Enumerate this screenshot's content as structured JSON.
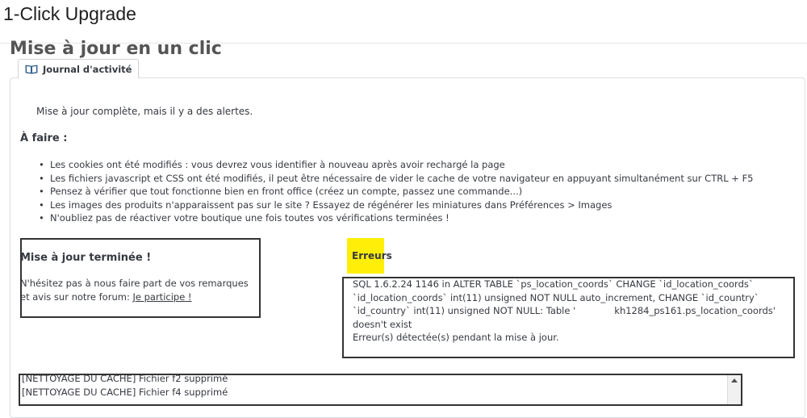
{
  "app": {
    "title": "1-Click Upgrade"
  },
  "page": {
    "title": "Mise à jour en un clic"
  },
  "tab": {
    "label": "Journal d'activité",
    "icon": "book-icon"
  },
  "status": {
    "message": "Mise à jour complète, mais il y a des alertes."
  },
  "todo": {
    "heading": "À faire :",
    "items": [
      "Les cookies ont été modifiés : vous devrez vous identifier à nouveau après avoir rechargé la page",
      "Les fichiers javascript et CSS ont été modifiés, il peut être nécessaire de vider le cache de votre navigateur en appuyant simultanément sur CTRL + F5",
      "Pensez à vérifier que tout fonctionne bien en front office (créez un compte, passez une commande...)",
      "Les images des produits n'apparaissent pas sur le site ? Essayez de régénérer les miniatures dans Préférences > Images",
      "N'oubliez pas de réactiver votre boutique une fois toutes vos vérifications terminées !"
    ]
  },
  "done_panel": {
    "title": "Mise à jour terminée !",
    "text": "N'hésitez pas à nous faire part de vos remarques et avis sur notre forum: ",
    "link": "Je participe !"
  },
  "errors": {
    "title": "Erreurs",
    "sql_before": "SQL 1.6.2.24 1146 in ALTER TABLE `ps_location_coords` CHANGE `id_location_coords` `id_location_coords` int(11) unsigned NOT NULL auto_increment, CHANGE `id_country` `id_country` int(11) unsigned NOT NULL: Table '",
    "sql_after": "kh1284_ps161.ps_location_coords' doesn't exist",
    "summary": "Erreur(s) détectée(s) pendant la mise à jour.",
    "highlight_color": "#ffef08"
  },
  "log": {
    "lines": [
      "[NETTOYAGE DU CACHE] Fichier f2 supprimé",
      "[NETTOYAGE DU CACHE] Fichier f4 supprimé"
    ]
  }
}
